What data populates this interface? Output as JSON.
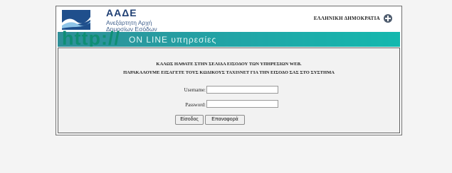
{
  "header": {
    "organization": "ΑΑΔΕ",
    "organization_sub_line1": "Ανεξάρτητη Αρχή",
    "organization_sub_line2": "Δημοσίων Εσόδων",
    "country": "ΕΛΛΗΝΙΚΗ ΔΗΜΟΚΡΑΤΙΑ",
    "banner_http": "http://",
    "banner_service": "ON LINE υπηρεσίες"
  },
  "login": {
    "welcome_line1": "ΚΑΛΩΣ ΗΛΘΑΤΕ ΣΤΗΝ ΣΕΛΙΔΑ ΕΙΣΟΔΟΥ ΤΩΝ ΥΠΗΡΕΣΙΩΝ WEB.",
    "welcome_line2": "ΠΑΡΑΚΑΛΟΥΜΕ ΕΙΣΑΓΕΤΕ ΤΟΥΣ ΚΩΔΙΚΟΥΣ TAXISNET ΓΙΑ ΤΗΝ ΕΙΣΟΔΟ ΣΑΣ ΣΤΟ ΣΥΣΤΗΜΑ",
    "username_label": "Username:",
    "password_label": "Password:",
    "username_value": "",
    "password_value": "",
    "login_button": "Είσοδος",
    "reset_button": "Επαναφορά"
  },
  "colors": {
    "page_background": "#f4f4f4",
    "content_background": "#f2f2f2",
    "banner_teal": "#20a6a7",
    "brand_blue": "#1f3f73"
  },
  "icons": {
    "logo": "aade-logo-icon",
    "emblem": "greek-emblem-icon"
  }
}
